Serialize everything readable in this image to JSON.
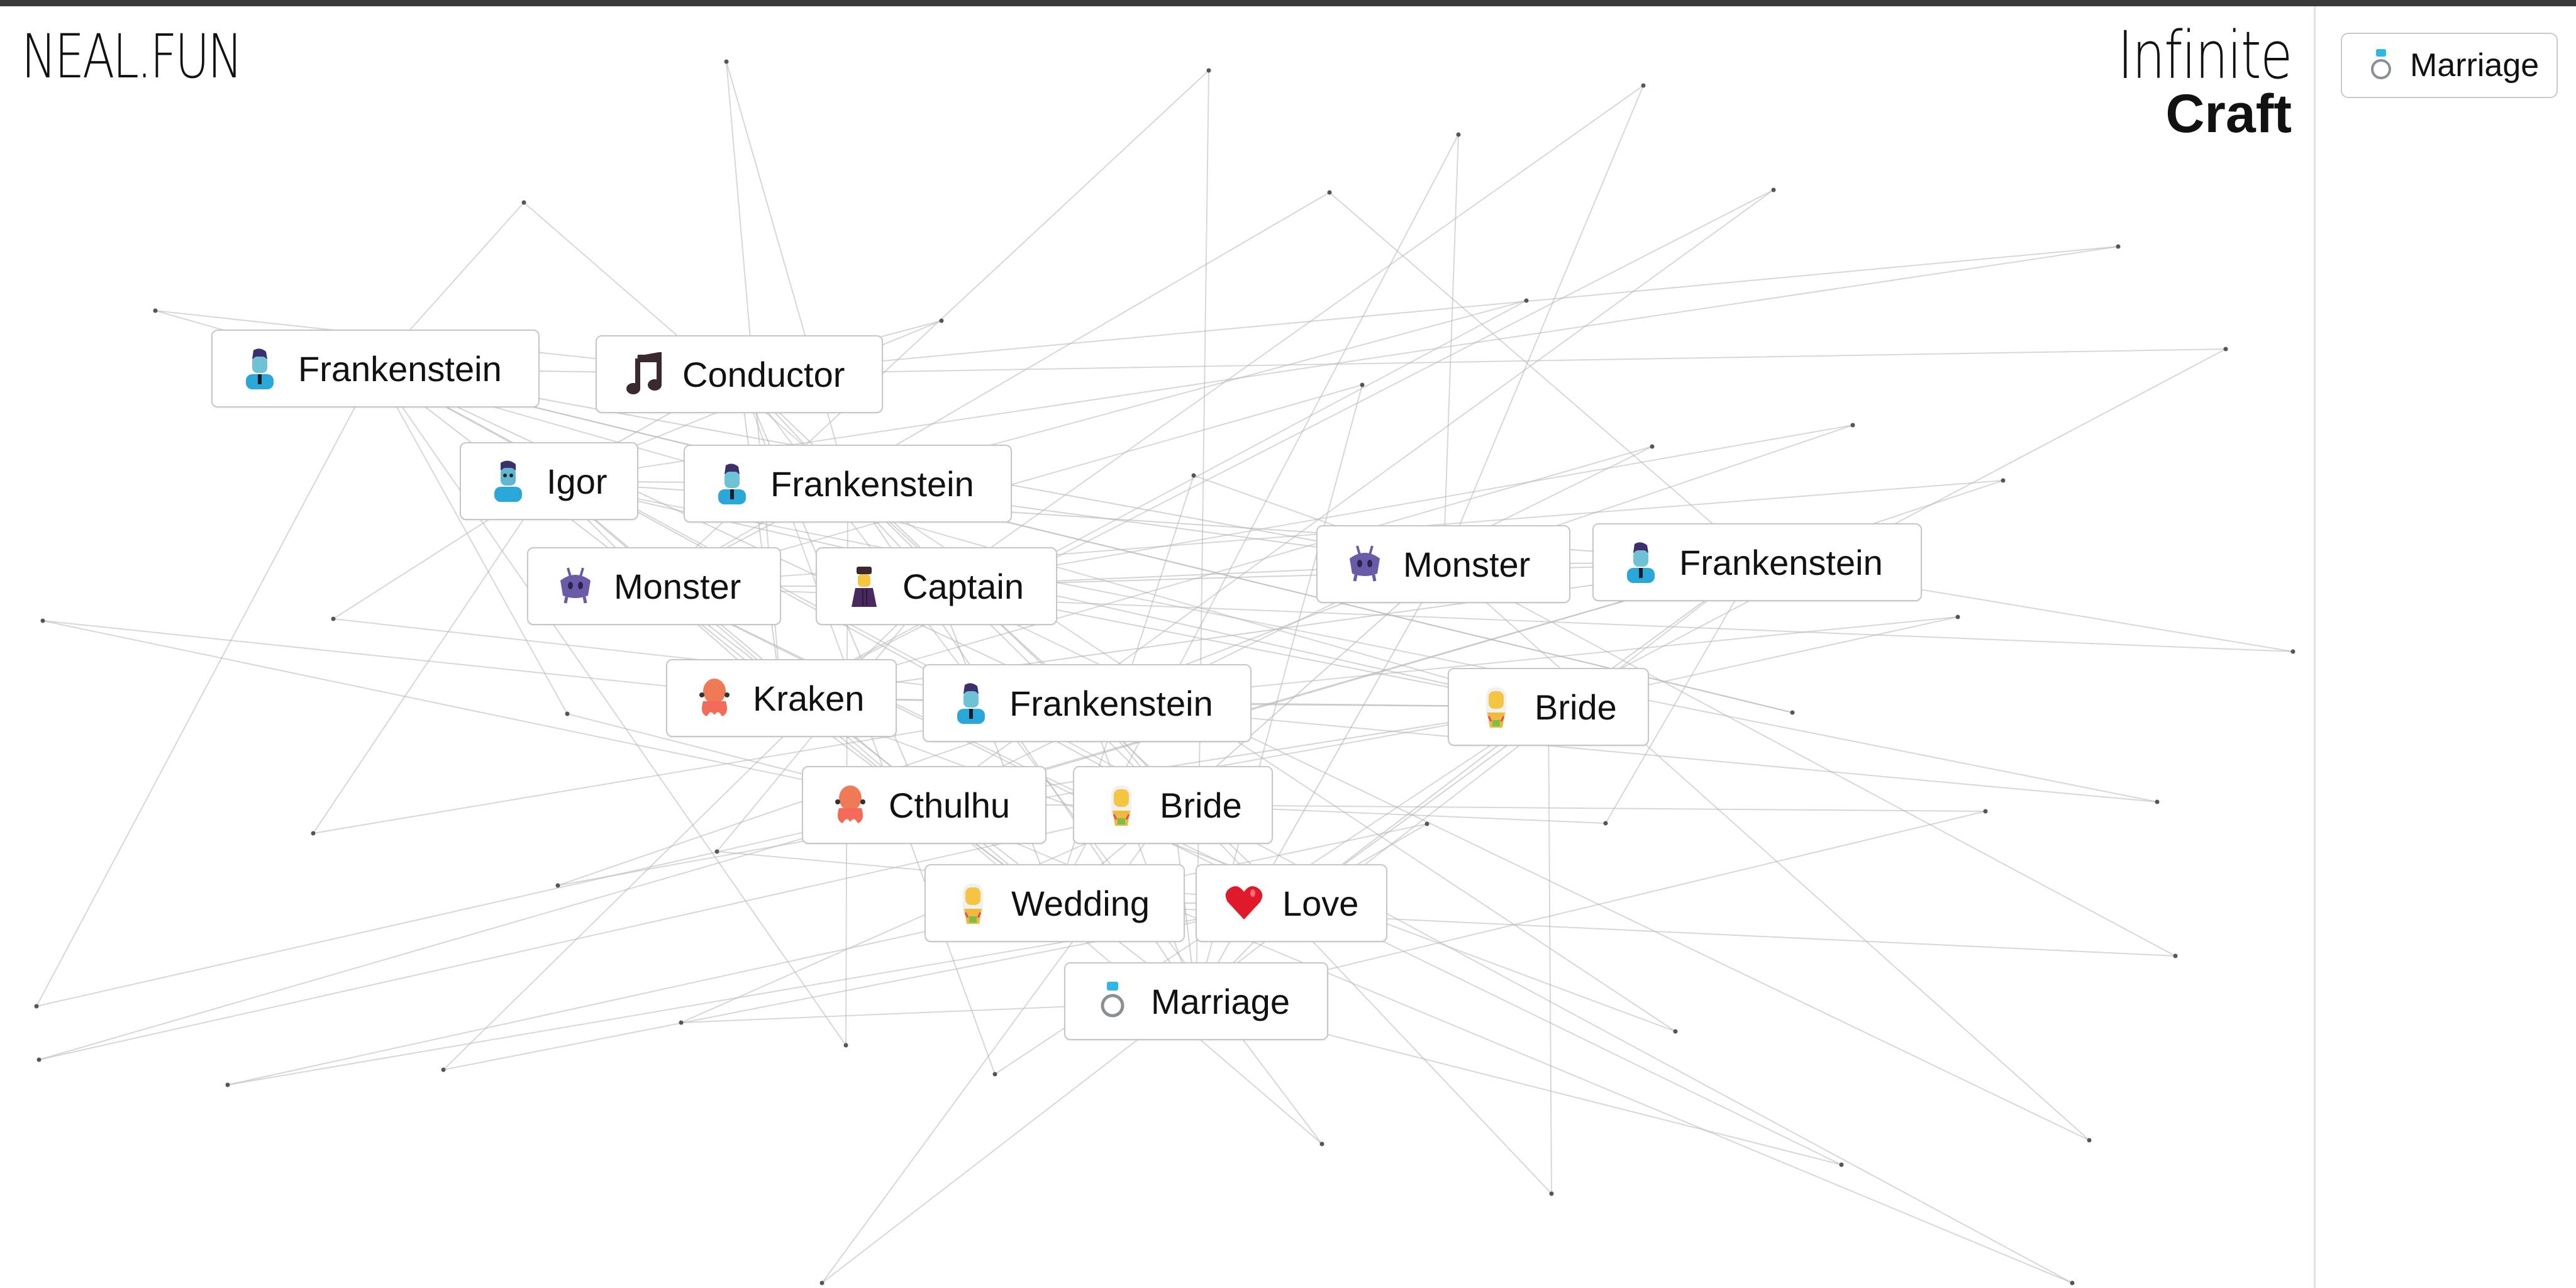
{
  "header": {
    "site_logo": "NEAL.FUN",
    "game_title_line1": "Infinite",
    "game_title_line2": "Craft",
    "topbar_color": "#3a3a3a"
  },
  "sidebar": {
    "items": [
      {
        "label": "Marriage",
        "icon": "ring-icon"
      }
    ]
  },
  "canvas": {
    "elements": [
      {
        "label": "Frankenstein",
        "icon": "frankenstein-icon"
      },
      {
        "label": "Conductor",
        "icon": "music-note-icon"
      },
      {
        "label": "Igor",
        "icon": "igor-icon"
      },
      {
        "label": "Frankenstein",
        "icon": "frankenstein-icon"
      },
      {
        "label": "Monster",
        "icon": "monster-icon"
      },
      {
        "label": "Captain",
        "icon": "captain-icon"
      },
      {
        "label": "Monster",
        "icon": "monster-icon"
      },
      {
        "label": "Frankenstein",
        "icon": "frankenstein-icon"
      },
      {
        "label": "Kraken",
        "icon": "octopus-icon"
      },
      {
        "label": "Frankenstein",
        "icon": "frankenstein-icon"
      },
      {
        "label": "Bride",
        "icon": "bride-icon"
      },
      {
        "label": "Cthulhu",
        "icon": "octopus-icon"
      },
      {
        "label": "Bride",
        "icon": "bride-icon"
      },
      {
        "label": "Wedding",
        "icon": "bride-icon"
      },
      {
        "label": "Love",
        "icon": "heart-icon"
      },
      {
        "label": "Marriage",
        "icon": "ring-icon"
      }
    ]
  },
  "colors": {
    "card_border": "#c4c8cc",
    "link_line": "#b8b8b8",
    "dot": "#555555",
    "sidebar_divider": "#e2e2e2"
  }
}
